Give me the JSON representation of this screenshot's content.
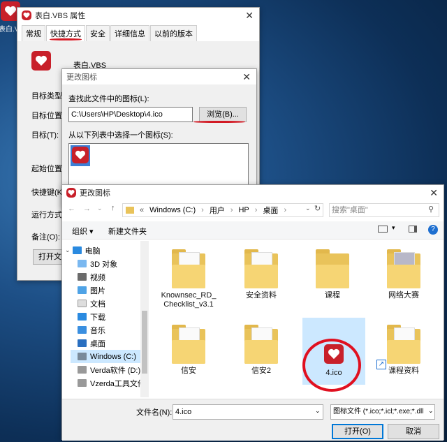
{
  "desktop": {
    "icon_label": "表白.VBS"
  },
  "props": {
    "title": "表白.VBS 属性",
    "tabs": [
      "常规",
      "快捷方式",
      "安全",
      "详细信息",
      "以前的版本"
    ],
    "filename": "表白.VBS",
    "labels": [
      "目标类型:",
      "目标位置:",
      "目标(T):",
      "起始位置(S",
      "快捷键(K)",
      "运行方式(R",
      "备注(O):"
    ],
    "open_btn": "打开文件"
  },
  "change_icon": {
    "title": "更改图标",
    "find_label": "查找此文件中的图标(L):",
    "path": "C:\\Users\\HP\\Desktop\\4.ico",
    "browse": "浏览(B)...",
    "select_label": "从以下列表中选择一个图标(S):"
  },
  "explorer": {
    "title": "更改图标",
    "breadcrumb": [
      "«",
      "Windows (C:)",
      "用户",
      "HP",
      "桌面"
    ],
    "search_placeholder": "搜索\"桌面\"",
    "toolbar": {
      "organize": "组织 ▾",
      "new_folder": "新建文件夹"
    },
    "tree": [
      "电脑",
      "3D 对象",
      "视频",
      "图片",
      "文档",
      "下载",
      "音乐",
      "桌面",
      "Windows (C:)",
      "Verda软件 (D:)",
      "Vzerda工具文件"
    ],
    "files": [
      "Knownsec_RD_Checklist_v3.1",
      "安全资料",
      "课程",
      "网络大赛",
      "信安",
      "信安2",
      "4.ico",
      "课程资料"
    ],
    "filename_label": "文件名(N):",
    "filename_value": "4.ico",
    "filter": "图标文件 (*.ico;*.icl;*.exe;*.dll",
    "open": "打开(O)",
    "cancel": "取消"
  },
  "colors": {
    "accent": "#d21a24",
    "selection": "#cce8ff"
  }
}
